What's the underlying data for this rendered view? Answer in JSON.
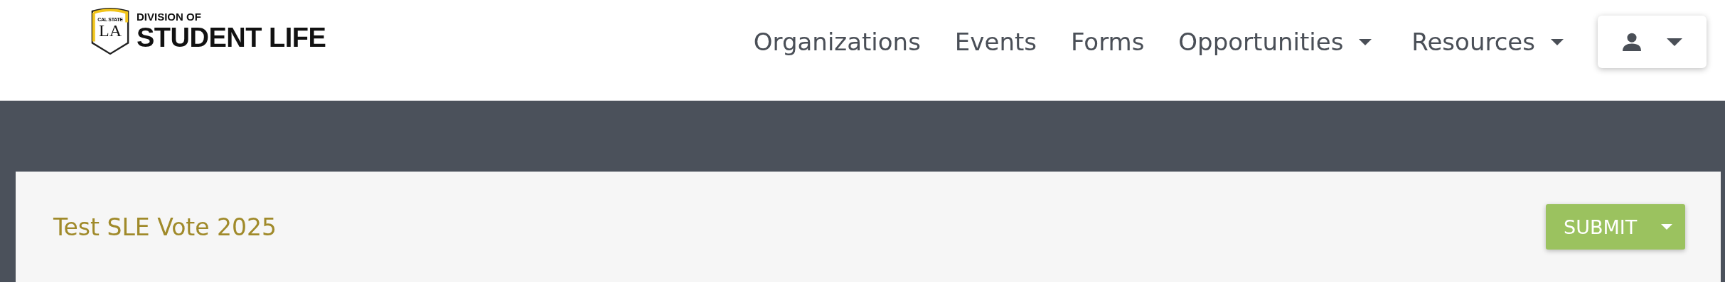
{
  "logo": {
    "seal_top": "CAL STATE",
    "seal_main": "LA",
    "line_1": "DIVISION OF",
    "line_2": "STUDENT LIFE"
  },
  "nav": [
    {
      "label": "Organizations",
      "kind": "link"
    },
    {
      "label": "Events",
      "kind": "link"
    },
    {
      "label": "Forms",
      "kind": "link"
    },
    {
      "label": "Opportunities",
      "kind": "dropdown"
    },
    {
      "label": "Resources",
      "kind": "dropdown"
    }
  ],
  "user_menu": {
    "kind": "account"
  },
  "card": {
    "title": "Test SLE Vote 2025",
    "button": {
      "label": "SUBMIT",
      "kind": "split"
    }
  }
}
